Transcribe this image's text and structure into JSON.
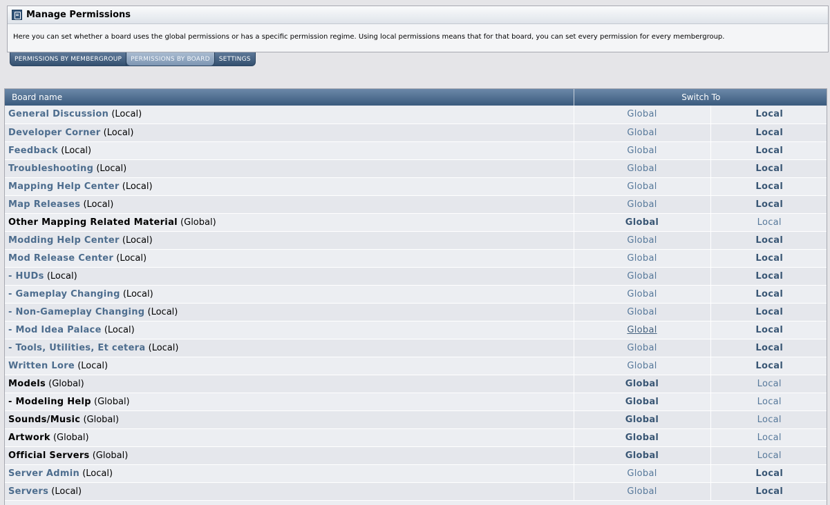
{
  "header": {
    "title": "Manage Permissions",
    "description": "Here you can set whether a board uses the global permissions or has a specific permission regime. Using local permissions means that for that board, you can set every permission for every membergroup."
  },
  "tabs": [
    {
      "label": "PERMISSIONS BY MEMBERGROUP",
      "active": false
    },
    {
      "label": "PERMISSIONS BY BOARD",
      "active": true
    },
    {
      "label": "SETTINGS",
      "active": false
    }
  ],
  "table": {
    "col_board": "Board name",
    "col_switch": "Switch To",
    "opt_global": "Global",
    "opt_local": "Local",
    "rows": [
      {
        "name": "General Discussion",
        "mode": "(Local)",
        "is_local": true
      },
      {
        "name": "Developer Corner",
        "mode": "(Local)",
        "is_local": true
      },
      {
        "name": "Feedback",
        "mode": "(Local)",
        "is_local": true
      },
      {
        "name": "Troubleshooting",
        "mode": "(Local)",
        "is_local": true
      },
      {
        "name": "Mapping Help Center",
        "mode": "(Local)",
        "is_local": true
      },
      {
        "name": "Map Releases",
        "mode": "(Local)",
        "is_local": true
      },
      {
        "name": "Other Mapping Related Material",
        "mode": "(Global)",
        "is_local": false
      },
      {
        "name": "Modding Help Center",
        "mode": "(Local)",
        "is_local": true
      },
      {
        "name": "Mod Release Center",
        "mode": "(Local)",
        "is_local": true
      },
      {
        "name": "- HUDs",
        "mode": "(Local)",
        "is_local": true
      },
      {
        "name": "- Gameplay Changing",
        "mode": "(Local)",
        "is_local": true
      },
      {
        "name": "- Non-Gameplay Changing",
        "mode": "(Local)",
        "is_local": true
      },
      {
        "name": "- Mod Idea Palace",
        "mode": "(Local)",
        "is_local": true,
        "hover": true
      },
      {
        "name": "- Tools, Utilities, Et cetera",
        "mode": "(Local)",
        "is_local": true
      },
      {
        "name": "Written Lore",
        "mode": "(Local)",
        "is_local": true
      },
      {
        "name": "Models",
        "mode": "(Global)",
        "is_local": false
      },
      {
        "name": "- Modeling Help",
        "mode": "(Global)",
        "is_local": false
      },
      {
        "name": "Sounds/Music",
        "mode": "(Global)",
        "is_local": false
      },
      {
        "name": "Artwork",
        "mode": "(Global)",
        "is_local": false
      },
      {
        "name": "Official Servers",
        "mode": "(Global)",
        "is_local": false
      },
      {
        "name": "Server Admin",
        "mode": "(Local)",
        "is_local": true
      },
      {
        "name": "Servers",
        "mode": "(Local)",
        "is_local": true
      }
    ]
  }
}
